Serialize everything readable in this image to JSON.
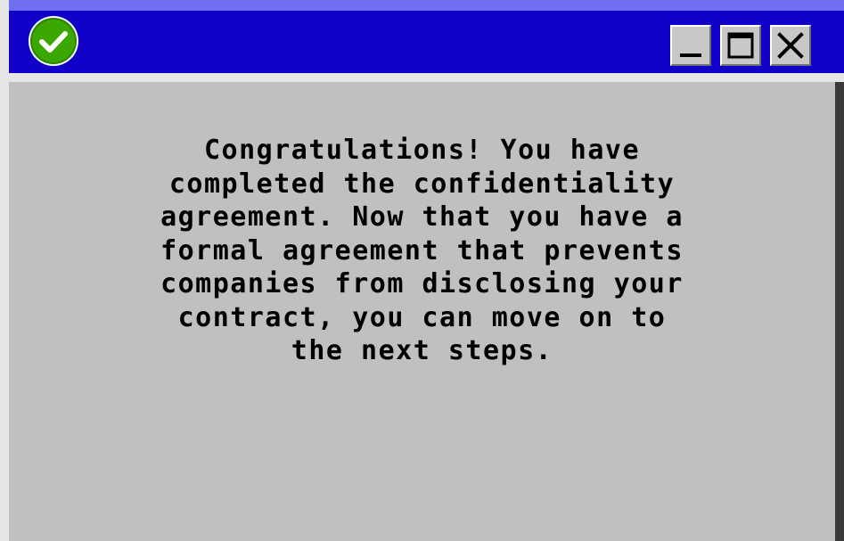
{
  "window": {
    "title_icon": "checkmark-circle-icon",
    "controls": [
      {
        "name": "minimize",
        "icon": "minimize-icon"
      },
      {
        "name": "maximize",
        "icon": "maximize-icon"
      },
      {
        "name": "close",
        "icon": "close-icon"
      }
    ],
    "colors": {
      "titlebar": "#1000c8",
      "titlebar_highlight": "#6f6ff0",
      "body": "#c0c0c0",
      "icon_green": "#3aa800",
      "text": "#000000"
    }
  },
  "dialog": {
    "message": "Congratulations! You have\ncompleted the confidentiality\nagreement. Now that you have a\nformal agreement that prevents\ncompanies from disclosing your\ncontract, you can move on to\nthe next steps."
  }
}
